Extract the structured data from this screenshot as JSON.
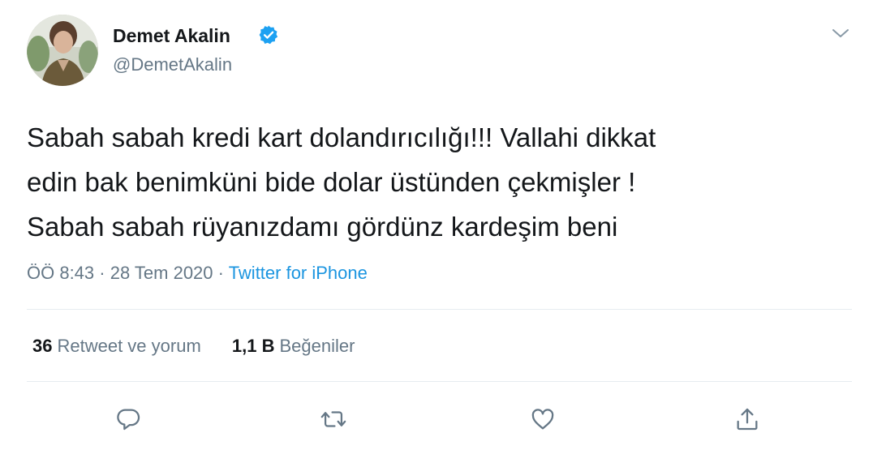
{
  "user": {
    "display_name": "Demet Akalin",
    "handle": "@DemetAkalin",
    "verified": true,
    "verified_icon": "verified-badge-icon",
    "avatar": "profile-photo"
  },
  "tweet": {
    "lines": [
      "Sabah sabah kredi kart dolandırıcılığı!!! Vallahi dikkat",
      "edin bak benimküni bide dolar üstünden çekmişler !",
      "Sabah sabah rüyanızdamı gördünz kardeşim beni"
    ]
  },
  "meta": {
    "time": "ÖÖ 8:43",
    "separator_1": " · ",
    "date": "28 Tem 2020",
    "separator_2": " · ",
    "source": "Twitter for iPhone"
  },
  "stats": {
    "retweets_count": "36",
    "retweets_label": "Retweet ve yorum",
    "likes_count": "1,1 B",
    "likes_label": "Beğeniler"
  },
  "actions": [
    {
      "name": "reply",
      "icon": "reply-icon"
    },
    {
      "name": "retweet",
      "icon": "retweet-icon"
    },
    {
      "name": "like",
      "icon": "heart-icon"
    },
    {
      "name": "share",
      "icon": "share-icon"
    }
  ],
  "colors": {
    "text_primary": "#14171a",
    "text_secondary": "#657786",
    "link": "#1b95e0",
    "verified_badge": "#1da1f2",
    "divider": "#e6ecf0"
  }
}
